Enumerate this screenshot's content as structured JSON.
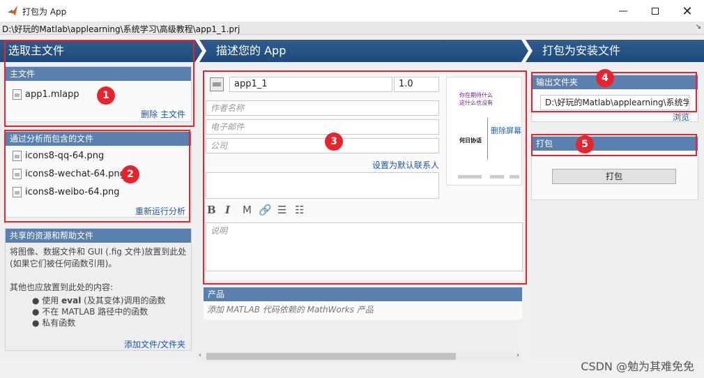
{
  "window": {
    "title": "打包为 App"
  },
  "path": {
    "text": "D:\\好玩的Matlab\\applearning\\系统学习\\高级教程\\app1_1.prj"
  },
  "steps": {
    "step1": "选取主文件",
    "step2": "描述您的 App",
    "step3": "打包为安装文件"
  },
  "main_file": {
    "header": "主文件",
    "file": "app1.mlapp",
    "remove_link": "删除 主文件"
  },
  "analyzed": {
    "header": "通过分析而包含的文件",
    "files": [
      "icons8-qq-64.png",
      "icons8-wechat-64.png",
      "icons8-weibo-64.png"
    ],
    "rerun_link": "重新运行分析"
  },
  "shared": {
    "header": "共享的资源和帮助文件",
    "desc1": "将图像、数据文件和 GUI (.fig 文件)放置到此处",
    "desc2": "(如果它们被任何函数引用)。",
    "desc3": "其他也应放置到此处的内容:",
    "bullet1_prefix": "使用",
    "bullet1_bold": "eval",
    "bullet1_suffix": "(及其变体)调用的函数",
    "bullet2": "不在 MATLAB 路径中的函数",
    "bullet3": "私有函数",
    "add_link": "添加文件/文件夹"
  },
  "describe": {
    "app_name": "app1_1",
    "version": "1.0",
    "author_placeholder": "作者名称",
    "email_placeholder": "电子邮件",
    "company_placeholder": "公司",
    "default_contact_link": "设置为默认联系人",
    "summary_value": "",
    "toolbar": [
      "B",
      "I",
      "M",
      "🔗",
      "☰",
      "☷"
    ],
    "description_placeholder": "说明",
    "screenshot": {
      "line1": "你在期待什么",
      "line2": "这什么也没有",
      "line3": "何日协话",
      "delete_label": "删除屏幕"
    }
  },
  "products": {
    "header": "产品",
    "placeholder": "添加 MATLAB 代码依赖的 MathWorks 产品"
  },
  "output": {
    "header": "输出文件夹",
    "folder": "D:\\好玩的Matlab\\applearning\\系统学",
    "browse_link": "浏览"
  },
  "package": {
    "header": "打包",
    "button": "打包"
  },
  "badges": [
    "1",
    "2",
    "3",
    "4",
    "5"
  ],
  "watermark": "CSDN @勉为其难免免",
  "colors": {
    "header_blue": "#1f4a7b",
    "panel_blue": "#5a80b0",
    "link": "#1f56a4",
    "annotation_red": "#e8232d"
  }
}
